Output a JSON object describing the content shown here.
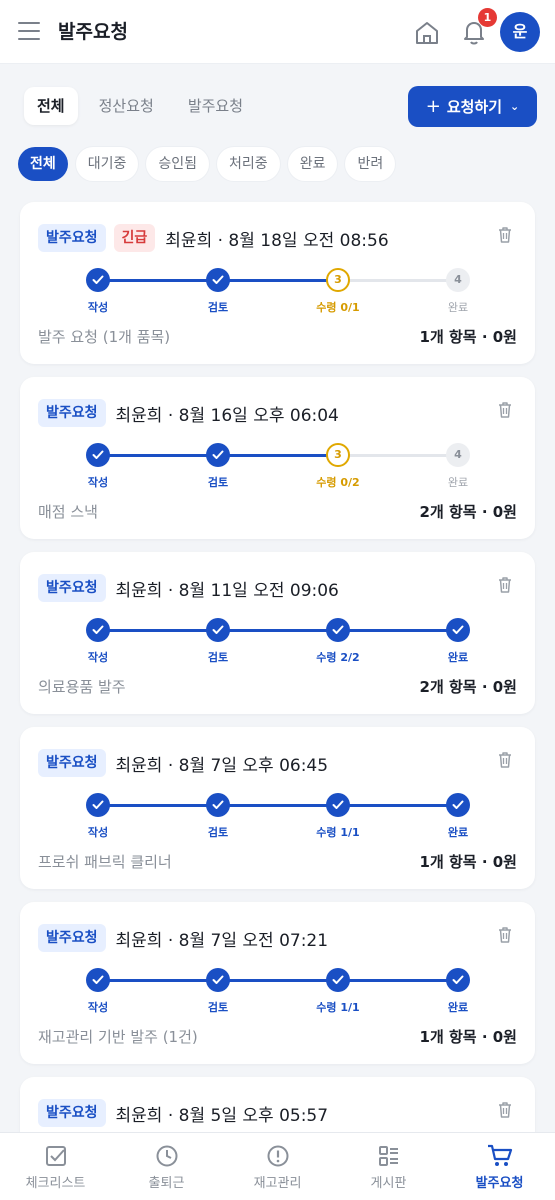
{
  "header": {
    "title": "발주요청",
    "notification_count": "1",
    "avatar_initial": "운"
  },
  "tabs": [
    {
      "label": "전체",
      "active": true
    },
    {
      "label": "정산요청",
      "active": false
    },
    {
      "label": "발주요청",
      "active": false
    }
  ],
  "request_button": {
    "label": "요청하기"
  },
  "filters": [
    {
      "label": "전체",
      "active": true
    },
    {
      "label": "대기중",
      "active": false
    },
    {
      "label": "승인됨",
      "active": false
    },
    {
      "label": "처리중",
      "active": false
    },
    {
      "label": "완료",
      "active": false
    },
    {
      "label": "반려",
      "active": false
    }
  ],
  "cards": [
    {
      "tag": "발주요청",
      "urgent": "긴급",
      "meta": "최윤희 · 8월 18일 오전 08:56",
      "steps": [
        {
          "label": "작성",
          "state": "done"
        },
        {
          "label": "검토",
          "state": "done"
        },
        {
          "label": "수령 0/1",
          "state": "current",
          "number": "3"
        },
        {
          "label": "완료",
          "state": "todo",
          "number": "4"
        }
      ],
      "description": "발주 요청 (1개 품목)",
      "summary": "1개 항목 · 0원"
    },
    {
      "tag": "발주요청",
      "meta": "최윤희 · 8월 16일 오후 06:04",
      "steps": [
        {
          "label": "작성",
          "state": "done"
        },
        {
          "label": "검토",
          "state": "done"
        },
        {
          "label": "수령 0/2",
          "state": "current",
          "number": "3"
        },
        {
          "label": "완료",
          "state": "todo",
          "number": "4"
        }
      ],
      "description": "매점 스낵",
      "summary": "2개 항목 · 0원"
    },
    {
      "tag": "발주요청",
      "meta": "최윤희 · 8월 11일 오전 09:06",
      "steps": [
        {
          "label": "작성",
          "state": "done"
        },
        {
          "label": "검토",
          "state": "done"
        },
        {
          "label": "수령 2/2",
          "state": "done"
        },
        {
          "label": "완료",
          "state": "done"
        }
      ],
      "description": "의료용품 발주",
      "summary": "2개 항목 · 0원"
    },
    {
      "tag": "발주요청",
      "meta": "최윤희 · 8월 7일 오후 06:45",
      "steps": [
        {
          "label": "작성",
          "state": "done"
        },
        {
          "label": "검토",
          "state": "done"
        },
        {
          "label": "수령 1/1",
          "state": "done"
        },
        {
          "label": "완료",
          "state": "done"
        }
      ],
      "description": "프로쉬 패브릭 클리너",
      "summary": "1개 항목 · 0원"
    },
    {
      "tag": "발주요청",
      "meta": "최윤희 · 8월 7일 오전 07:21",
      "steps": [
        {
          "label": "작성",
          "state": "done"
        },
        {
          "label": "검토",
          "state": "done"
        },
        {
          "label": "수령 1/1",
          "state": "done"
        },
        {
          "label": "완료",
          "state": "done"
        }
      ],
      "description": "재고관리 기반 발주 (1건)",
      "summary": "1개 항목 · 0원"
    },
    {
      "tag": "발주요청",
      "meta": "최윤희 · 8월 5일 오후 05:57"
    }
  ],
  "bottom_nav": [
    {
      "label": "체크리스트",
      "icon": "checklist-icon",
      "active": false
    },
    {
      "label": "출퇴근",
      "icon": "clock-icon",
      "active": false
    },
    {
      "label": "재고관리",
      "icon": "alert-circle-icon",
      "active": false
    },
    {
      "label": "게시판",
      "icon": "board-icon",
      "active": false
    },
    {
      "label": "발주요청",
      "icon": "cart-icon",
      "active": true
    }
  ],
  "colors": {
    "primary": "#1a4fc4",
    "current_step": "#e0a800",
    "urgent": "#d63b3b",
    "background": "#f3f5f8"
  }
}
